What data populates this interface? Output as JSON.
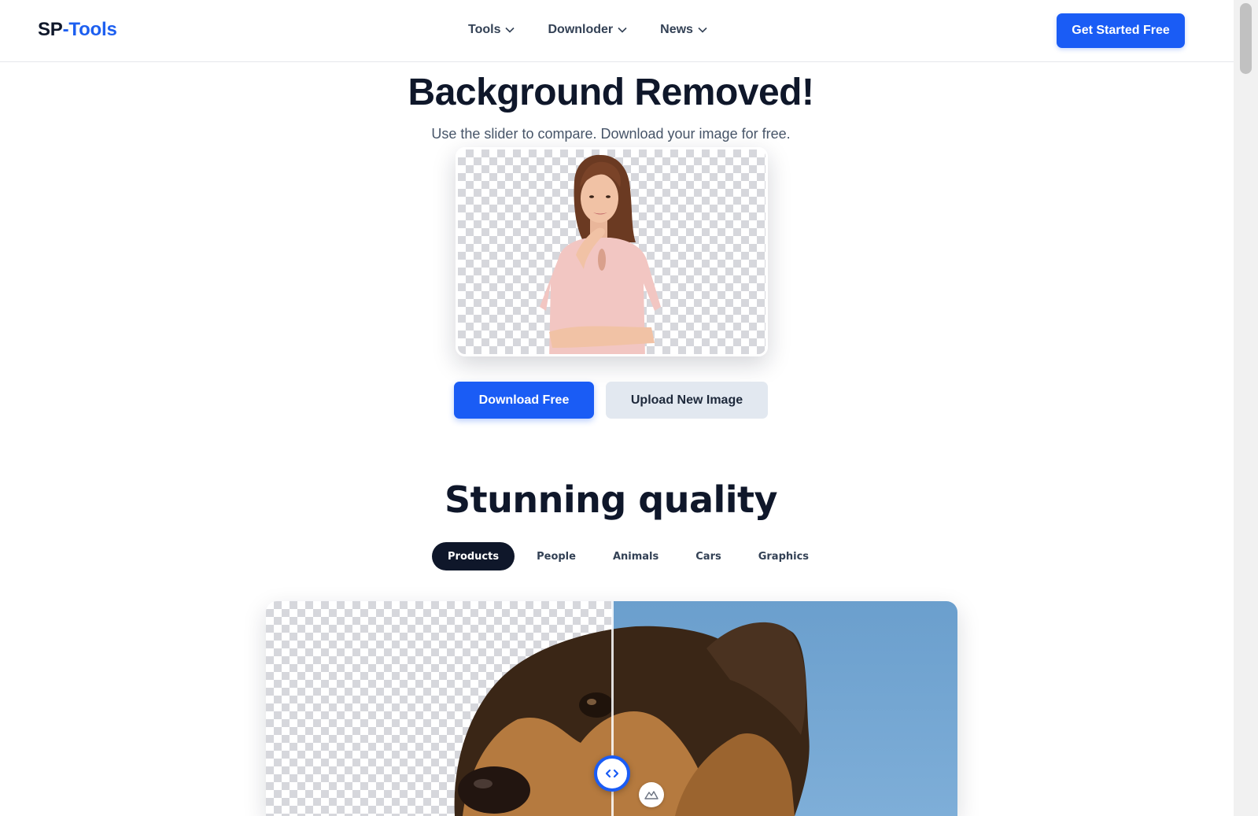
{
  "header": {
    "logo_part1": "SP",
    "logo_part2": "-Tools",
    "nav": [
      {
        "label": "Tools"
      },
      {
        "label": "Downloder"
      },
      {
        "label": "News"
      }
    ],
    "cta_label": "Get Started Free"
  },
  "hero": {
    "title": "Background Removed!",
    "subtitle": "Use the slider to compare. Download your image for free.",
    "download_label": "Download Free",
    "upload_label": "Upload New Image"
  },
  "quality": {
    "title": "Stunning quality",
    "tabs": [
      {
        "label": "Products",
        "active": true
      },
      {
        "label": "People",
        "active": false
      },
      {
        "label": "Animals",
        "active": false
      },
      {
        "label": "Cars",
        "active": false
      },
      {
        "label": "Graphics",
        "active": false
      }
    ],
    "slider_position": 0.5
  },
  "colors": {
    "accent": "#1a5cf5",
    "text": "#0f172a",
    "muted": "#475569",
    "secondary_button": "#e2e8f0",
    "sky": "#6b9fcd"
  },
  "icons": {
    "nav_chevron": "chevron-down-icon",
    "slider_handle": "arrows-left-right-icon",
    "badge": "mountain-icon"
  }
}
